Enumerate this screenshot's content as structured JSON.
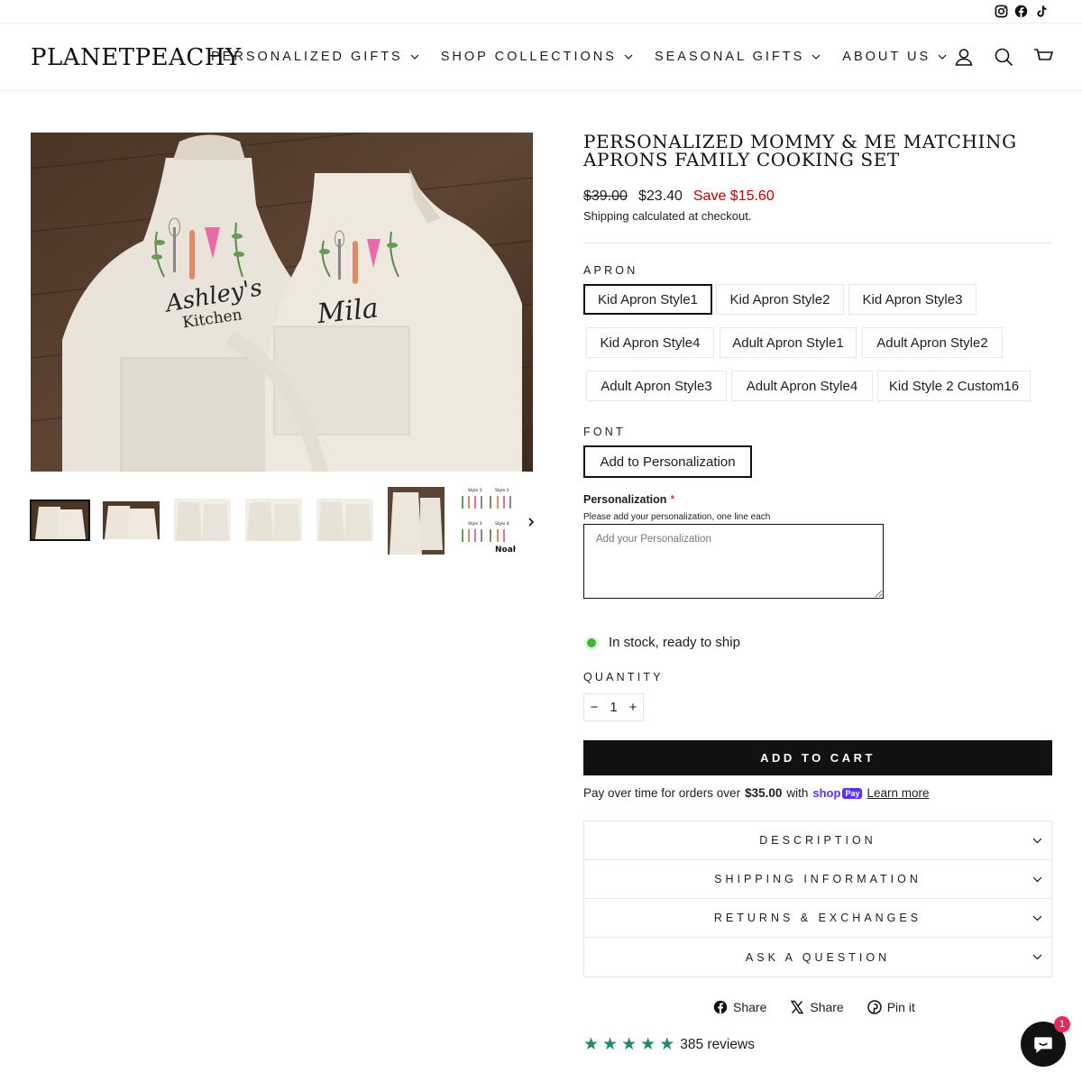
{
  "social": {
    "icons": [
      "instagram-icon",
      "facebook-icon",
      "tiktok-icon"
    ]
  },
  "header": {
    "logo": "PLANETPEACHY",
    "nav": [
      "PERSONALIZED GIFTS",
      "SHOP COLLECTIONS",
      "SEASONAL GIFTS",
      "ABOUT US"
    ],
    "icons": [
      "account-icon",
      "search-icon",
      "cart-icon"
    ]
  },
  "gallery": {
    "main_image_text": {
      "line1": "Ashley's",
      "line2": "Kitchen",
      "name2": "Mila"
    },
    "thumb_count": 7,
    "thumb7_text": {
      "s1": "Style 1",
      "s2": "Style 2",
      "s3": "Style 3",
      "s4": "Style 4",
      "noah": "Noah"
    }
  },
  "product": {
    "title": "PERSONALIZED MOMMY & ME MATCHING APRONS FAMILY COOKING SET",
    "price_old": "$39.00",
    "price_new": "$23.40",
    "save": "Save $15.60",
    "shipping_note": "Shipping calculated at checkout.",
    "apron_label": "APRON",
    "apron_options": [
      "Kid Apron Style1",
      "Kid Apron Style2",
      "Kid Apron Style3",
      "Kid Apron Style4",
      "Adult Apron Style1",
      "Adult Apron Style2",
      "Adult Apron Style3",
      "Adult Apron Style4",
      "Kid Style 2 Custom16"
    ],
    "apron_selected": "Kid Apron Style1",
    "font_label": "FONT",
    "font_option": "Add to Personalization",
    "personalization_label": "Personalization",
    "personalization_required": "*",
    "personalization_help": "Please add your personalization, one line each",
    "personalization_placeholder": "Add your Personalization",
    "stock": "In stock, ready to ship",
    "quantity_label": "QUANTITY",
    "quantity": "1",
    "qty_minus": "−",
    "qty_plus": "+",
    "add_to_cart": "ADD TO CART",
    "payover_prefix": "Pay over time for orders over",
    "payover_amount": "$35.00",
    "payover_with": "with",
    "shoppay_brand": "shop",
    "shoppay_pay": "Pay",
    "learn_more": "Learn more",
    "accordion": [
      "DESCRIPTION",
      "SHIPPING INFORMATION",
      "RETURNS & EXCHANGES",
      "ASK A QUESTION"
    ],
    "share": [
      "Share",
      "Share",
      "Pin it"
    ],
    "rating_stars": 5,
    "reviews": "385 reviews"
  },
  "chat": {
    "badge": "1"
  },
  "colors": {
    "accent_red": "#c20000",
    "stock_green": "#3cb930",
    "star_green": "#1f8a70",
    "shoppay_purple": "#5a31f4"
  }
}
